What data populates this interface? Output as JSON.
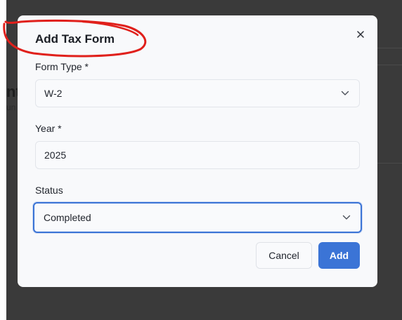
{
  "background": {
    "heading_fragment": "nt",
    "subtext_fragment": "un"
  },
  "modal": {
    "title": "Add Tax Form",
    "fields": {
      "form_type": {
        "label": "Form Type *",
        "value": "W-2"
      },
      "year": {
        "label": "Year *",
        "value": "2025"
      },
      "status": {
        "label": "Status",
        "value": "Completed"
      }
    },
    "actions": {
      "cancel_label": "Cancel",
      "add_label": "Add"
    }
  },
  "colors": {
    "accent": "#3b74d6",
    "annotation": "#e0201b"
  }
}
